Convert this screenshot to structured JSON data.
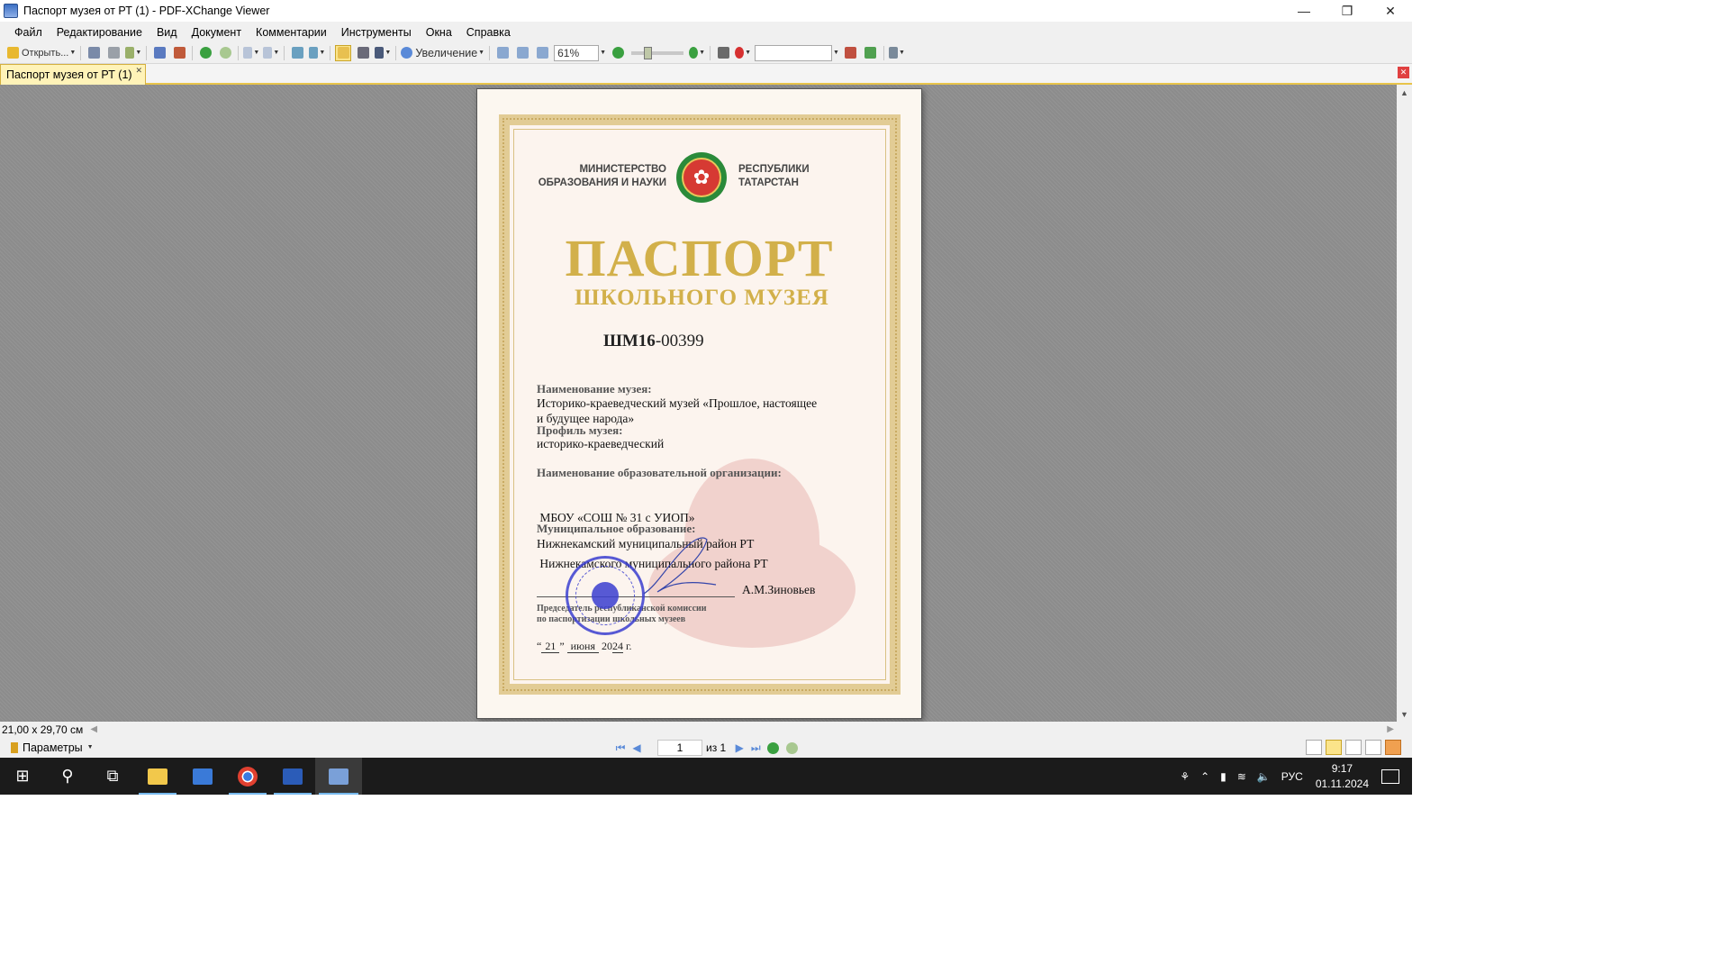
{
  "window": {
    "title": "Паспорт музея от РТ (1) - PDF-XChange Viewer"
  },
  "menu": [
    "Файл",
    "Редактирование",
    "Вид",
    "Документ",
    "Комментарии",
    "Инструменты",
    "Окна",
    "Справка"
  ],
  "toolbar": {
    "open_label": "Открыть...",
    "zoom_tool_label": "Увеличение",
    "zoom_value": "61%",
    "search_value": ""
  },
  "tab": {
    "label": "Паспорт музея от РТ (1)"
  },
  "document": {
    "ministry_line1": "МИНИСТЕРСТВО",
    "ministry_line2": "ОБРАЗОВАНИЯ И НАУКИ",
    "republic_line1": "РЕСПУБЛИКИ",
    "republic_line2": "ТАТАРСТАН",
    "title_main": "ПАСПОРТ",
    "title_sub": "ШКОЛЬНОГО МУЗЕЯ",
    "code_prefix": "ШМ16",
    "code_number": "-00399",
    "museum_name_label": "Наименование музея:",
    "museum_name_line1": "Историко-краеведческий музей «Прошлое, настоящее",
    "museum_name_line2": "и будущее народа»",
    "profile_label": "Профиль музея:",
    "profile_value": "историко-краеведческий",
    "org_label": "Наименование образовательной организации:",
    "org_line1": " МБОУ «СОШ № 31 с УИОП»",
    "org_line2": " Нижнекамского муниципального района РТ",
    "municipality_label": "Муниципальное образование:",
    "municipality_value": "Нижнекамский муниципальный район РТ",
    "signer_name": "А.М.Зиновьев",
    "chair_line1": "Председатель республиканской комиссии",
    "chair_line2": "по паспортизации школьных музеев",
    "date_quote_open": "“",
    "date_day": "21",
    "date_quote_close": "”",
    "date_month": "июня",
    "date_year_prefix": "20",
    "date_year_suffix": "24",
    "date_g": "г."
  },
  "status": {
    "page_size": "21,00 x 29,70 см"
  },
  "bottom": {
    "params_label": "Параметры",
    "page_current": "1",
    "page_of": "из 1"
  },
  "taskbar": {
    "lang": "РУС",
    "time": "9:17",
    "date": "01.11.2024"
  },
  "colors": {
    "gold_title": "#d2b04a",
    "tab_active": "#fff3b8",
    "stamp_blue": "#3b3fd0",
    "taskbar": "#1b1b1b"
  }
}
